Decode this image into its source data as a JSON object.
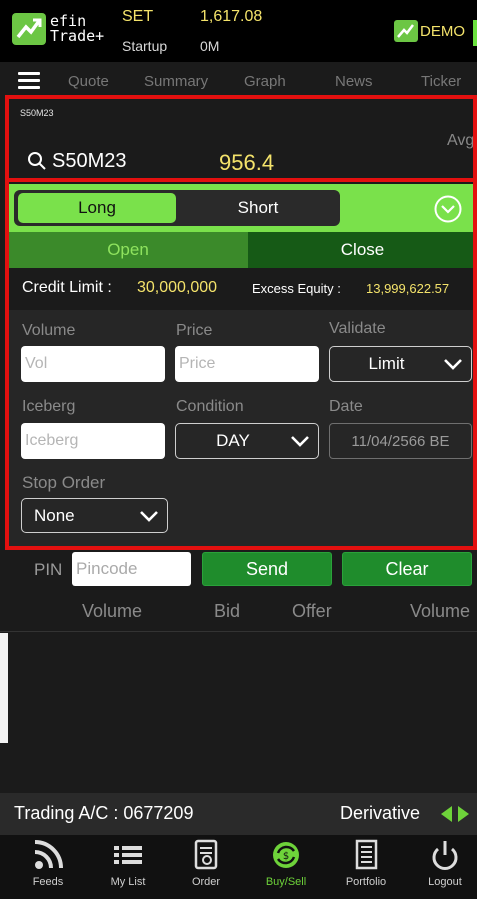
{
  "app": {
    "name_line1": "efin",
    "name_line2": "Trade+",
    "demo_label": "DEMO"
  },
  "market": {
    "name": "SET",
    "index": "1,617.08",
    "session": "Startup",
    "volume": "0M"
  },
  "nav": {
    "items": [
      "Quote",
      "Summary",
      "Graph",
      "News",
      "Ticker"
    ]
  },
  "symbol": {
    "small": "S50M23",
    "name": "S50M23",
    "price": "956.4",
    "avg_label": "Avg"
  },
  "order": {
    "side_long": "Long",
    "side_short": "Short",
    "tab_open": "Open",
    "tab_close": "Close",
    "credit_limit_label": "Credit Limit :",
    "credit_limit_value": "30,000,000",
    "excess_equity_label": "Excess Equity :",
    "excess_equity_value": "13,999,622.57",
    "volume_label": "Volume",
    "volume_placeholder": "Vol",
    "price_label": "Price",
    "price_placeholder": "Price",
    "validate_label": "Validate",
    "validate_value": "Limit",
    "iceberg_label": "Iceberg",
    "iceberg_placeholder": "Iceberg",
    "condition_label": "Condition",
    "condition_value": "DAY",
    "date_label": "Date",
    "date_value": "11/04/2566 BE",
    "stop_order_label": "Stop Order",
    "stop_order_value": "None"
  },
  "pin": {
    "label": "PIN",
    "placeholder": "Pincode",
    "send": "Send",
    "clear": "Clear"
  },
  "book": {
    "headers": [
      "Volume",
      "Bid",
      "Offer",
      "Volume"
    ]
  },
  "account": {
    "text": "Trading A/C : 0677209",
    "type": "Derivative"
  },
  "tabbar": {
    "items": [
      {
        "label": "Feeds",
        "icon": "feeds-icon"
      },
      {
        "label": "My List",
        "icon": "list-icon"
      },
      {
        "label": "Order",
        "icon": "order-icon"
      },
      {
        "label": "Buy/Sell",
        "icon": "buysell-icon",
        "active": true
      },
      {
        "label": "Portfolio",
        "icon": "portfolio-icon"
      },
      {
        "label": "Logout",
        "icon": "power-icon"
      }
    ]
  },
  "colors": {
    "accent_green": "#7ae14b",
    "highlight_yellow": "#f4e36b",
    "frame_red": "#e3100f"
  }
}
